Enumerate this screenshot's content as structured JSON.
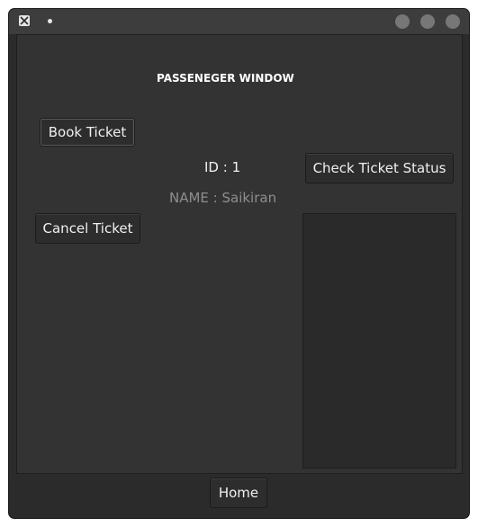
{
  "window": {
    "title_dot": "•"
  },
  "main": {
    "heading": "PASSENEGER WINDOW",
    "book_ticket_label": "Book Ticket",
    "check_status_label": "Check Ticket Status",
    "cancel_ticket_label": "Cancel Ticket",
    "id_text": "ID : 1",
    "name_text": "NAME : Saikiran"
  },
  "footer": {
    "home_label": "Home"
  },
  "icons": {
    "app": "x11-icon",
    "minimize": "minimize-button-icon",
    "maximize": "maximize-button-icon",
    "close": "close-button-icon"
  },
  "colors": {
    "window_bg": "#2b2b2b",
    "titlebar_bg": "#3d3d3d",
    "content_bg": "#333333",
    "text_primary": "#f0f0f0",
    "text_muted": "#8e8e8e"
  }
}
